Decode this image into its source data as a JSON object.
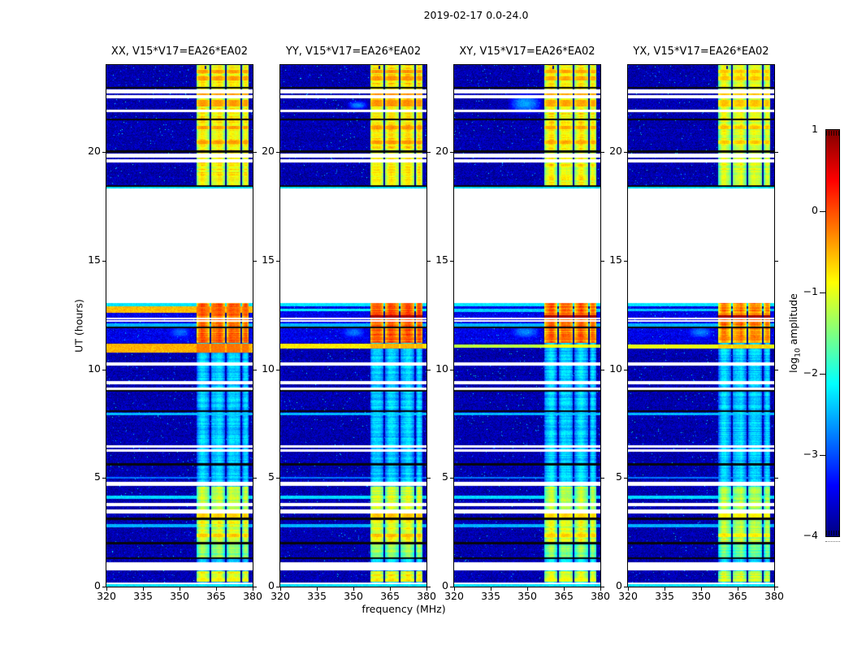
{
  "figure": {
    "title": "2019-02-17 0.0-24.0",
    "xlabel": "frequency (MHz)",
    "ylabel": "UT (hours)",
    "background_color": "#ffffff"
  },
  "colorbar": {
    "label_prefix": "log",
    "label_sub": "10",
    "label_suffix": " amplitude",
    "tick_labels": [
      "1",
      "0",
      "−1",
      "−2",
      "−3",
      "−4"
    ],
    "tick_values": [
      1,
      0,
      -1,
      -2,
      -3,
      -4
    ],
    "value_range": [
      -4,
      1
    ]
  },
  "axes": {
    "x_tick_labels": [
      "320",
      "335",
      "350",
      "365",
      "380"
    ],
    "x_tick_fracs": [
      0,
      0.25,
      0.5,
      0.75,
      1
    ],
    "y_tick_labels": [
      "0",
      "5",
      "10",
      "15",
      "20"
    ],
    "y_tick_hours": [
      0,
      5,
      10,
      15,
      20
    ]
  },
  "chart_data": {
    "type": "heatmap",
    "title": "2019-02-17 0.0-24.0",
    "xlabel": "frequency (MHz)",
    "ylabel": "UT (hours)",
    "value_label": "log10 amplitude",
    "value_range": [
      -4,
      1
    ],
    "x_range_mhz": [
      320,
      380
    ],
    "y_range_hours": [
      0,
      24
    ],
    "colormap": "jet",
    "jet_stops": [
      [
        0,
        "#000080"
      ],
      [
        0.125,
        "#0000ff"
      ],
      [
        0.375,
        "#00ffff"
      ],
      [
        0.625,
        "#ffff00"
      ],
      [
        0.875,
        "#ff0000"
      ],
      [
        1,
        "#800000"
      ]
    ],
    "background_level": -3.78,
    "noise_amplitude": 0.55,
    "rfi_band": {
      "f_range": [
        356.8,
        378.6
      ],
      "subbands": [
        [
          357.1,
          362.2
        ],
        [
          362.9,
          368.7
        ],
        [
          369.3,
          375.1
        ],
        [
          375.8,
          378.3
        ]
      ]
    },
    "time_gaps_hours": [
      [
        13.06,
        18.33
      ],
      [
        0.76,
        1.12
      ],
      [
        22.7,
        22.87
      ],
      [
        22.47,
        22.6
      ],
      [
        21.82,
        21.93
      ],
      [
        19.74,
        19.94
      ],
      [
        19.51,
        19.68
      ],
      [
        12.2,
        12.27
      ],
      [
        12.31,
        12.38
      ],
      [
        10.17,
        10.32
      ],
      [
        9.32,
        9.44
      ],
      [
        9.06,
        9.16
      ],
      [
        6.4,
        6.5
      ],
      [
        6.22,
        6.32
      ],
      [
        4.63,
        4.82
      ],
      [
        3.7,
        3.86
      ],
      [
        3.38,
        3.54
      ],
      [
        0.1,
        0.18
      ]
    ],
    "flagged_black_hours": [
      22.95,
      21.5,
      20.02,
      18.44,
      11.92,
      9.0,
      8.08,
      5.62,
      3.12,
      2.0,
      1.31
    ],
    "cyan_rows": [
      {
        "h": 18.37,
        "w": 0.13,
        "v": -2.25
      },
      {
        "h": 12.98,
        "w": 0.13,
        "v": -2.25
      },
      {
        "h": 12.02,
        "w": 0.15,
        "v": -2.5
      },
      {
        "h": 7.95,
        "w": 0.12,
        "v": -2.45
      },
      {
        "h": 4.1,
        "w": 0.16,
        "v": -2.3
      },
      {
        "h": 2.8,
        "w": 0.12,
        "v": -2.5
      },
      {
        "h": 0.06,
        "w": 0.1,
        "v": -2.3
      },
      {
        "h": 5.0,
        "w": 0.06,
        "v": -2.8
      }
    ],
    "bright_sections": [
      {
        "h": [
          18.45,
          24.0
        ],
        "v": -1.15,
        "rows": [
          23.7,
          23.38,
          22.62,
          22.3,
          22.18,
          21.12,
          20.45
        ],
        "row_v": -0.35
      },
      {
        "h": [
          11.2,
          13.06
        ],
        "v": -0.45,
        "rows": [
          12.52,
          11.4
        ],
        "row_v": -0.08
      },
      {
        "h": [
          3.15,
          4.58
        ],
        "v": -1.5,
        "rows": [
          3.27
        ],
        "row_v": -0.6
      },
      {
        "h": [
          2.05,
          3.08
        ],
        "v": -1.35,
        "rows": [
          2.35
        ],
        "row_v": -0.55
      },
      {
        "h": [
          1.35,
          1.98
        ],
        "v": -1.75,
        "rows": [],
        "row_v": -1.3
      },
      {
        "h": [
          0.22,
          0.72
        ],
        "v": -1.25,
        "rows": [
          0.3
        ],
        "row_v": -0.8
      }
    ],
    "top_artifacts_mhz": [
      [
        325.4,
        326.2
      ],
      [
        342.6,
        343.8
      ],
      [
        360.3,
        361.1
      ]
    ],
    "panels": [
      {
        "pol": "XX",
        "title": "XX, V15*V17=EA26*EA02",
        "band_gain": 0,
        "streaks": [
          {
            "h": 12.74,
            "w": 0.32,
            "v": -0.55
          },
          {
            "h": 10.98,
            "w": 0.42,
            "v": -0.5
          }
        ],
        "wisps": [
          {
            "h": [
              11.3,
              12.1
            ],
            "f": [
              344,
              356.5
            ],
            "v": -2.85
          }
        ],
        "maroon_rows": []
      },
      {
        "pol": "YY",
        "title": "YY, V15*V17=EA26*EA02",
        "band_gain": 0.05,
        "streaks": [
          {
            "h": 12.72,
            "w": 0.12,
            "v": -2.15
          },
          {
            "h": 11.07,
            "w": 0.2,
            "v": -0.8
          }
        ],
        "wisps": [
          {
            "h": [
              21.9,
              22.4
            ],
            "f": [
              347,
              356.5
            ],
            "v": -2.7
          },
          {
            "h": [
              11.3,
              12.1
            ],
            "f": [
              344,
              356.5
            ],
            "v": -2.8
          }
        ],
        "maroon_rows": [
          {
            "h": 12.42,
            "w": 0.1,
            "v": 0.82
          }
        ]
      },
      {
        "pol": "XY",
        "title": "XY, V15*V17=EA26*EA02",
        "band_gain": -0.05,
        "streaks": [
          {
            "h": 12.72,
            "w": 0.14,
            "v": -2.35
          },
          {
            "h": 11.07,
            "w": 0.16,
            "v": -1.2
          }
        ],
        "wisps": [
          {
            "h": [
              21.7,
              22.75
            ],
            "f": [
              342,
              356.5
            ],
            "v": -2.55
          },
          {
            "h": [
              11.3,
              12.15
            ],
            "f": [
              342,
              356.5
            ],
            "v": -2.7
          }
        ],
        "maroon_rows": [
          {
            "h": 12.42,
            "w": 0.1,
            "v": 0.82
          }
        ]
      },
      {
        "pol": "YX",
        "title": "YX, V15*V17=EA26*EA02",
        "band_gain": -0.2,
        "streaks": [
          {
            "h": 12.72,
            "w": 0.12,
            "v": -2.4
          },
          {
            "h": 11.05,
            "w": 0.2,
            "v": -0.95
          }
        ],
        "wisps": [
          {
            "h": [
              11.3,
              12.1
            ],
            "f": [
              343,
              356.5
            ],
            "v": -2.75
          }
        ],
        "maroon_rows": [
          {
            "h": 12.42,
            "w": 0.1,
            "v": 0.82
          }
        ]
      }
    ]
  }
}
